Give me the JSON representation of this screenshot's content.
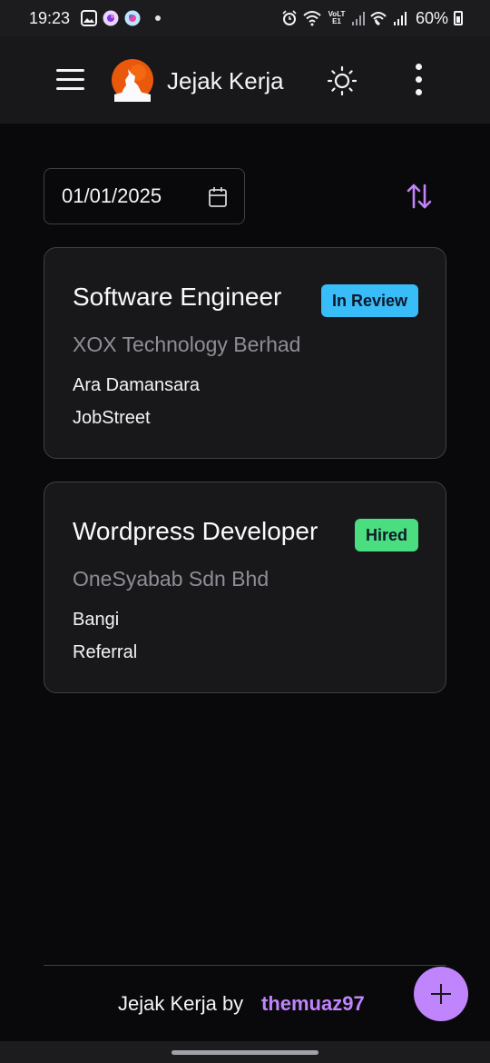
{
  "status_bar": {
    "time": "19:23",
    "battery": "60%",
    "icons": [
      "gallery-icon",
      "app-icon",
      "app-icon",
      "notification-dot",
      "alarm-icon",
      "wifi-icon",
      "volte-icon",
      "signal-icon",
      "wifi-calling-icon",
      "signal-icon",
      "battery-icon"
    ],
    "lte_label": "VoLTE1"
  },
  "app_bar": {
    "title": "Jejak Kerja",
    "icons": {
      "menu": "menu-icon",
      "logo": "wolf-logo",
      "theme": "sun-icon",
      "more": "more-vertical-icon"
    }
  },
  "filter": {
    "date_value": "01/01/2025",
    "icons": {
      "date": "calendar-icon",
      "sort": "sort-arrows-icon"
    }
  },
  "jobs": [
    {
      "title": "Software Engineer",
      "company": "XOX Technology Berhad",
      "location": "Ara Damansara",
      "source": "JobStreet",
      "status": "In Review",
      "status_color": "#38bdf8"
    },
    {
      "title": "Wordpress Developer",
      "company": "OneSyabab Sdn Bhd",
      "location": "Bangi",
      "source": "Referral",
      "status": "Hired",
      "status_color": "#4ade80"
    }
  ],
  "footer": {
    "text": "Jejak Kerja by",
    "author": "themuaz97"
  },
  "fab": {
    "icon": "plus-icon"
  },
  "colors": {
    "accent": "#c084fc",
    "background": "#09090b",
    "surface": "#18181b",
    "border": "#3f3f46"
  }
}
